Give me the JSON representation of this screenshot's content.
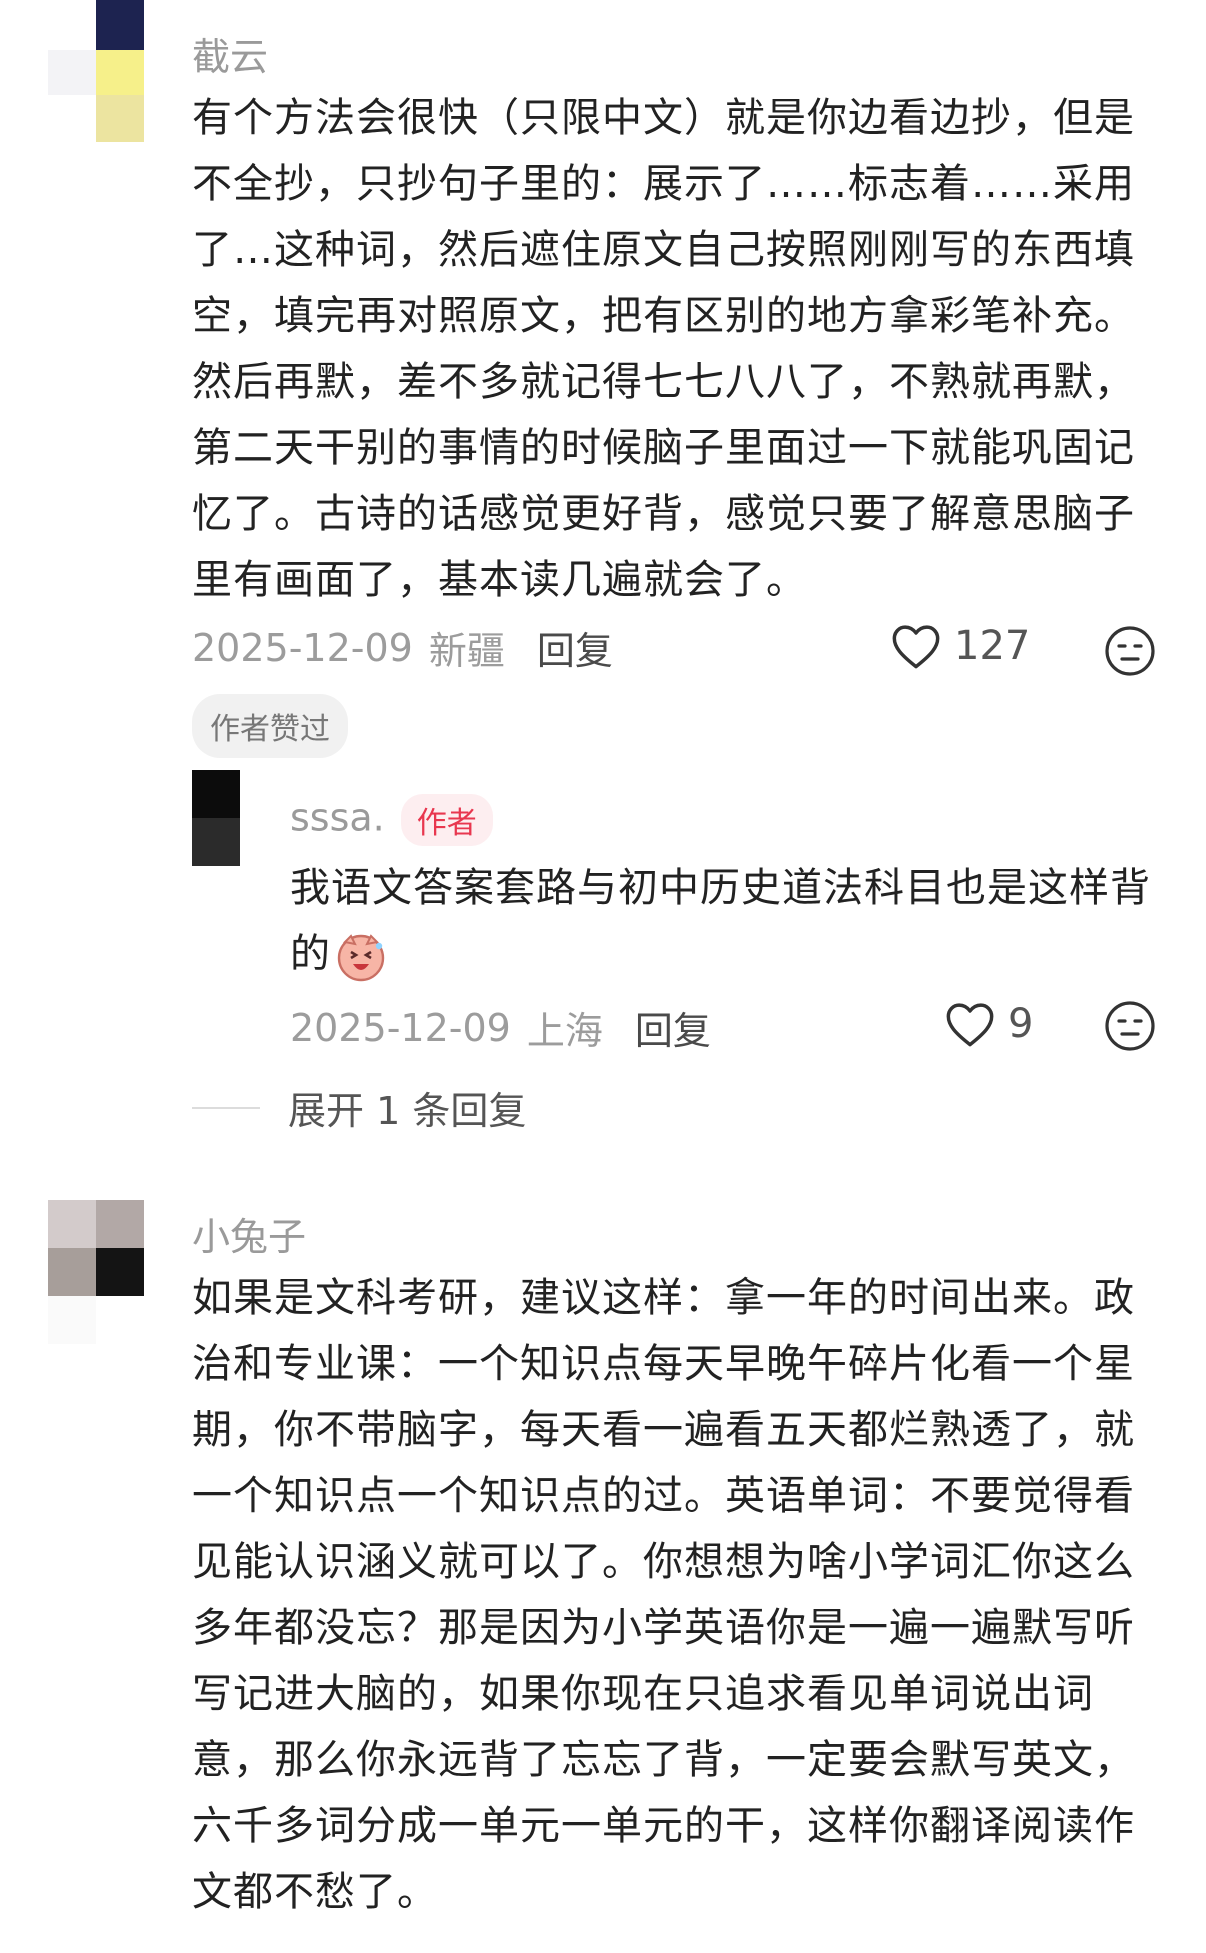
{
  "comments": [
    {
      "username": "截云",
      "content": "有个方法会很快（只限中文）就是你边看边抄，但是不全抄，只抄句子里的：展示了……标志着……采用了…这种词，然后遮住原文自己按照刚刚写的东西填空，填完再对照原文，把有区别的地方拿彩笔补充。然后再默，差不多就记得七七八八了，不熟就再默，第二天干别的事情的时候脑子里面过一下就能巩固记忆了。古诗的话感觉更好背，感觉只要了解意思脑子里有画面了，基本读几遍就会了。",
      "date": "2025-12-09",
      "location": "新疆",
      "reply_label": "回复",
      "likes": "127",
      "liked_badge": "作者赞过",
      "replies": [
        {
          "username": "sssa.",
          "author_badge": "作者",
          "content": "我语文答案套路与初中历史道法科目也是这样背的",
          "date": "2025-12-09",
          "location": "上海",
          "reply_label": "回复",
          "likes": "9"
        }
      ],
      "expand_label": "展开 1 条回复"
    },
    {
      "username": "小兔子",
      "content": "如果是文科考研，建议这样：拿一年的时间出来。政治和专业课：一个知识点每天早晚午碎片化看一个星期，你不带脑字，每天看一遍看五天都烂熟透了，就一个知识点一个知识点的过。英语单词：不要觉得看见能认识涵义就可以了。你想想为啥小学词汇你这么多年都没忘？那是因为小学英语你是一遍一遍默写听写记进大脑的，如果你现在只追求看见单词说出词意，那么你永远背了忘忘了背，一定要会默写英文，六千多词分成一单元一单元的干，这样你翻译阅读作文都不愁了。"
    }
  ],
  "icons": {
    "like": "heart-outline-icon",
    "dislike": "meh-face-icon",
    "emoji": "laughing-pig-emoji"
  },
  "colors": {
    "author_badge_bg": "#fdeef0",
    "author_badge_text": "#e8374f",
    "meta_text": "#9c9c9c"
  }
}
